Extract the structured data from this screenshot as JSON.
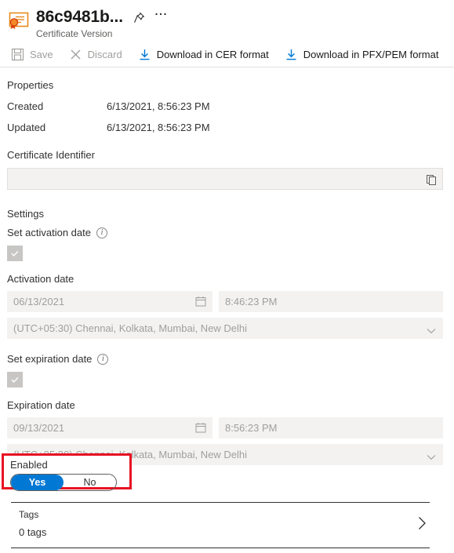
{
  "header": {
    "icon": "certificate-icon",
    "title": "86c9481b...",
    "subtitle": "Certificate Version",
    "pin_icon": "pin-icon",
    "more_icon": "ellipsis-icon"
  },
  "toolbar": {
    "save_label": "Save",
    "save_icon": "save-icon",
    "discard_label": "Discard",
    "discard_icon": "close-icon",
    "download_cer_label": "Download in CER format",
    "download_cer_icon": "download-icon",
    "download_pfx_label": "Download in PFX/PEM format",
    "download_pfx_icon": "download-icon"
  },
  "properties": {
    "heading": "Properties",
    "created_label": "Created",
    "created_value": "6/13/2021, 8:56:23 PM",
    "updated_label": "Updated",
    "updated_value": "6/13/2021, 8:56:23 PM",
    "identifier_label": "Certificate Identifier",
    "identifier_value": "",
    "copy_icon": "copy-icon"
  },
  "settings": {
    "heading": "Settings",
    "activation": {
      "toggle_label": "Set activation date",
      "info_icon": "info-icon",
      "checkbox_checked": "✓",
      "date_label": "Activation date",
      "date_value": "06/13/2021",
      "calendar_icon": "calendar-icon",
      "time_value": "8:46:23 PM",
      "timezone_value": "(UTC+05:30) Chennai, Kolkata, Mumbai, New Delhi",
      "chevron_icon": "chevron-down-icon"
    },
    "expiration": {
      "toggle_label": "Set expiration date",
      "info_icon": "info-icon",
      "checkbox_checked": "✓",
      "date_label": "Expiration date",
      "date_value": "09/13/2021",
      "calendar_icon": "calendar-icon",
      "time_value": "8:56:23 PM",
      "timezone_value": "(UTC+05:30) Chennai, Kolkata, Mumbai, New Delhi",
      "chevron_icon": "chevron-down-icon"
    }
  },
  "enabled": {
    "label": "Enabled",
    "yes_label": "Yes",
    "no_label": "No",
    "selected": "Yes",
    "highlight_color": "#e81123",
    "accent_color": "#0078d4"
  },
  "tags": {
    "title": "Tags",
    "count_label": "0 tags",
    "chevron_icon": "chevron-right-icon"
  }
}
